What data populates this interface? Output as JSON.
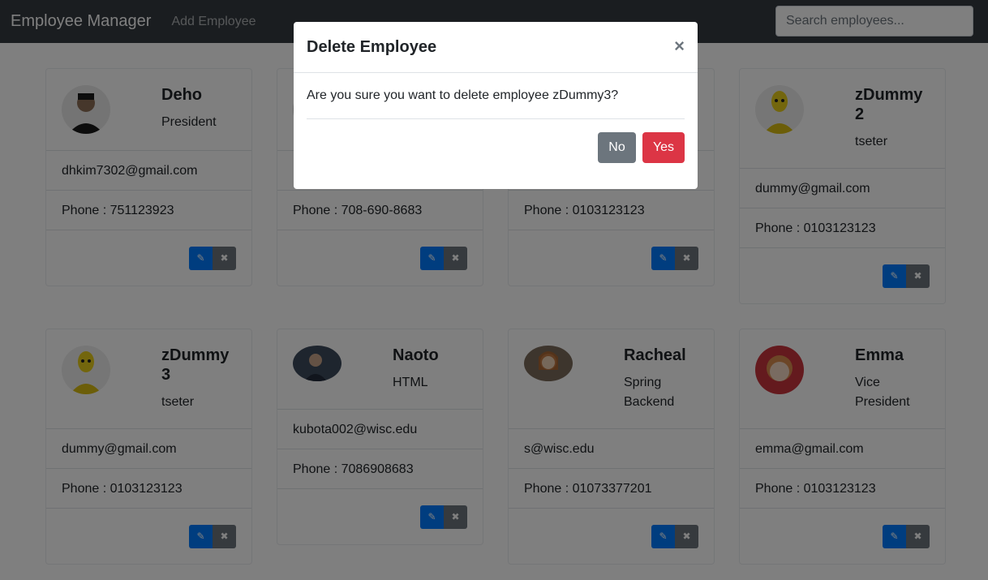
{
  "navbar": {
    "brand": "Employee Manager",
    "add_link": "Add Employee",
    "search_placeholder": "Search employees..."
  },
  "employees": [
    {
      "name": "Deho",
      "title": "President",
      "email": "dhkim7302@gmail.com",
      "phone": "Phone : 751123923"
    },
    {
      "name": "",
      "title": "",
      "email": "",
      "phone": "Phone : 708-690-8683"
    },
    {
      "name": "",
      "title": "",
      "email": "",
      "phone": "Phone : 0103123123"
    },
    {
      "name": "zDummy 2",
      "title": "tseter",
      "email": "dummy@gmail.com",
      "phone": "Phone : 0103123123"
    },
    {
      "name": "zDummy 3",
      "title": "tseter",
      "email": "dummy@gmail.com",
      "phone": "Phone : 0103123123"
    },
    {
      "name": "Naoto",
      "title": "HTML",
      "email": "kubota002@wisc.edu",
      "phone": "Phone : 7086908683"
    },
    {
      "name": "Racheal",
      "title": "Spring Backend",
      "email": "s@wisc.edu",
      "phone": "Phone : 01073377201"
    },
    {
      "name": "Emma",
      "title": "Vice President",
      "email": "emma@gmail.com",
      "phone": "Phone : 0103123123"
    }
  ],
  "icons": {
    "edit": "pencil-icon",
    "delete": "close-icon"
  },
  "modal": {
    "title": "Delete Employee",
    "close_label": "×",
    "message": "Are you sure you want to delete employee zDummy3?",
    "no_label": "No",
    "yes_label": "Yes"
  },
  "colors": {
    "primary": "#007bff",
    "secondary": "#6c757d",
    "danger": "#dc3545",
    "navbar": "#343a40"
  }
}
